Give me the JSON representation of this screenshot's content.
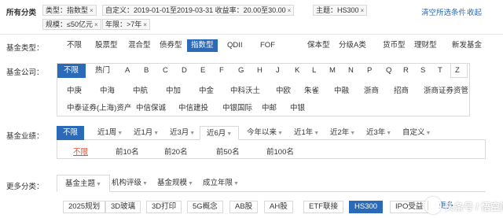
{
  "summary": {
    "label": "所有分类",
    "chips": [
      {
        "text": "类型：指数型"
      },
      {
        "text": "自定义：2019-01-01至2019-03-31 收益率：20.00至30.00"
      },
      {
        "text": "主题：HS300"
      },
      {
        "text": "规模：≤50亿元"
      },
      {
        "text": "年限：>7年"
      }
    ],
    "close_glyph": "×",
    "clear_all": "清空所选条件",
    "collapse": "收起"
  },
  "fund_type": {
    "label": "基金类型：",
    "options": [
      "不限",
      "股票型",
      "混合型",
      "债券型",
      "指数型",
      "QDII",
      "FOF",
      "保本型",
      "分级A类",
      "货币型",
      "理财型",
      "新发基金"
    ],
    "active_index": 4
  },
  "fund_company": {
    "label": "基金公司：",
    "tabs": [
      "不限",
      "热门",
      "A",
      "B",
      "C",
      "D",
      "E",
      "F",
      "G",
      "H",
      "J",
      "K",
      "L",
      "M",
      "N",
      "P",
      "Q",
      "R",
      "S",
      "T",
      "W",
      "X",
      "Y",
      "Z"
    ],
    "active_index": 0,
    "row1": [
      "中庚",
      "中海",
      "中航",
      "中加",
      "中金",
      "中科沃土",
      "中欧",
      "朱雀",
      "中融",
      "浙商",
      "招商",
      "浙商证券资管"
    ],
    "row2": [
      "中泰证券(上海)资产",
      "中信保诚",
      "中信建投",
      "中银国际",
      "中邮",
      "中银"
    ]
  },
  "performance": {
    "label": "基金业绩：",
    "tabs": [
      "不限",
      "近1周",
      "近1月",
      "近3月",
      "近6月",
      "今年以来",
      "近1年",
      "近2年",
      "近3年",
      "自定义"
    ],
    "active_index": 0,
    "boxed_index": 4,
    "dropdown_glyph": "▼",
    "rank_options": [
      "不限",
      "前10名",
      "前20名",
      "前50名",
      "前100名"
    ],
    "rank_active_index": 0
  },
  "more": {
    "label": "更多分类：",
    "tabs": [
      "基金主题",
      "机构评级",
      "基金规模",
      "成立年限"
    ],
    "boxed_index": 0,
    "themes": [
      "2025规划",
      "3D玻璃",
      "3D打印",
      "5G概念",
      "AB股",
      "AH股",
      "ETF联接",
      "HS300",
      "IPO受益",
      "更多"
    ],
    "theme_active_index": 7
  },
  "watermark": {
    "text": "头条号 / 悟空问答"
  },
  "colors": {
    "accent": "#2a6ab8",
    "highlight": "#e94c2c",
    "border": "#d9d9d9"
  }
}
